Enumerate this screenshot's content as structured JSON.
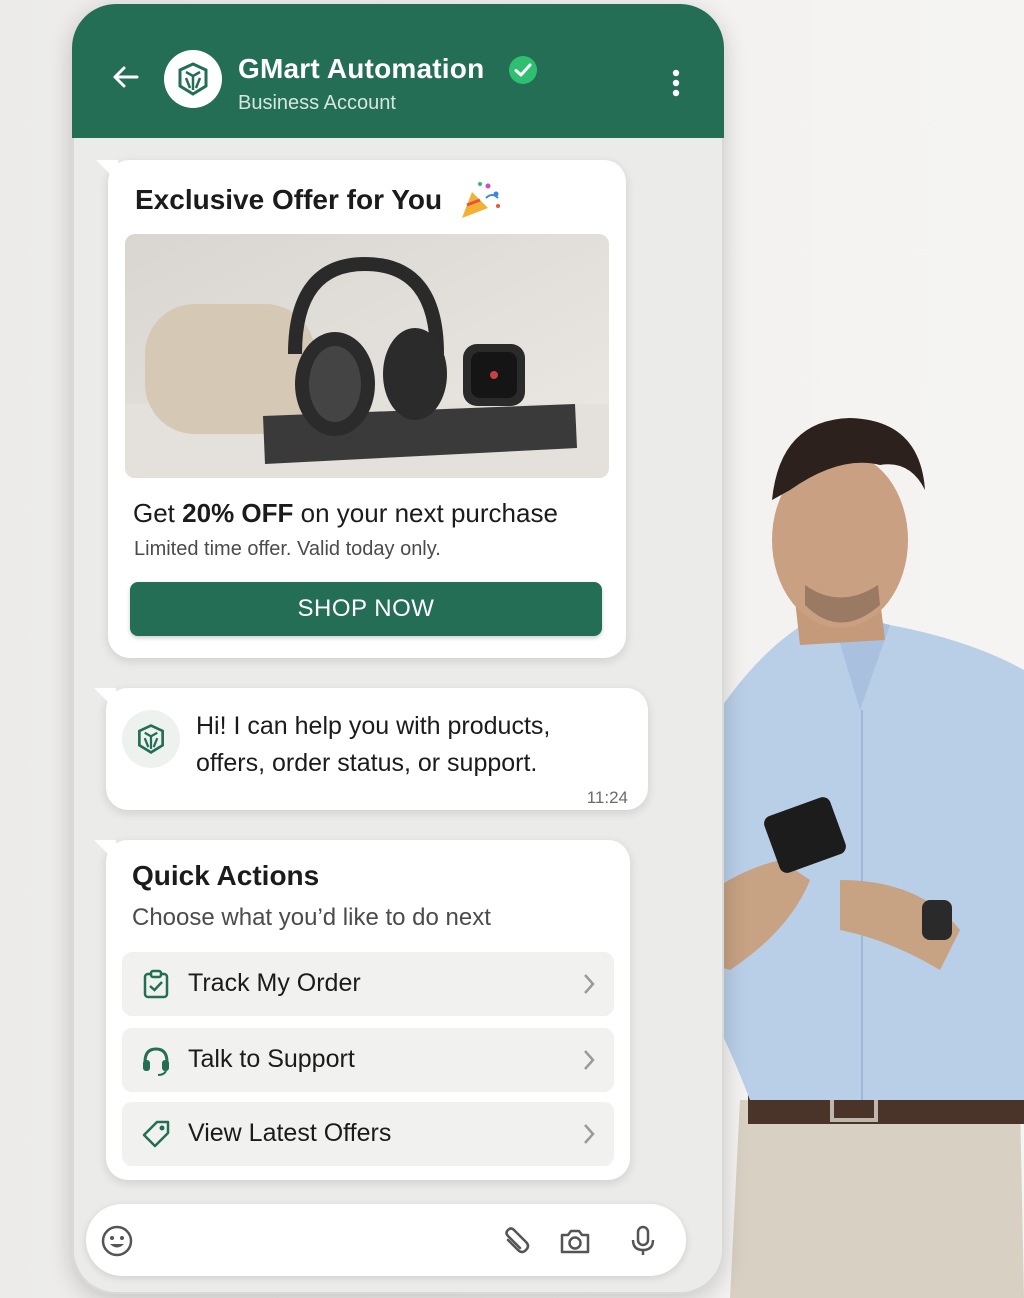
{
  "header": {
    "title": "GMart Automation",
    "subtitle": "Business Account"
  },
  "offer": {
    "title": "Exclusive Offer for You",
    "headline_prefix": "Get",
    "headline_bold": "20% OFF",
    "headline_suffix": "on your next purchase",
    "note": "Limited time offer. Valid today only.",
    "button_label": "SHOP NOW"
  },
  "greeting": {
    "line1": "Hi! I can help you with products,",
    "line2": "offers, order status, or support.",
    "time": "11:24"
  },
  "quick_actions": {
    "title": "Quick Actions",
    "subtitle": "Choose what you’d like to do next",
    "items": [
      {
        "label": "Track My Order",
        "icon": "clipboard-check-icon"
      },
      {
        "label": "Talk to Support",
        "icon": "headset-icon"
      },
      {
        "label": "View Latest Offers",
        "icon": "tag-icon"
      }
    ]
  },
  "colors": {
    "brand": "#236e55",
    "verified": "#2fbf71"
  }
}
